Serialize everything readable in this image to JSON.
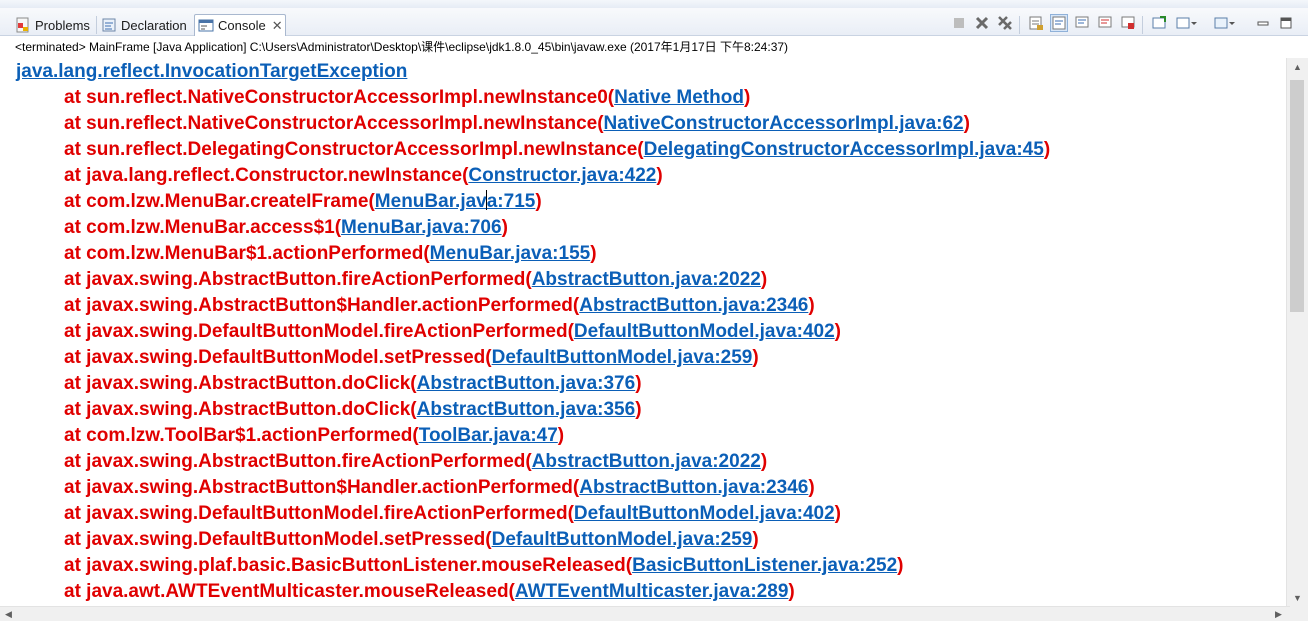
{
  "tabs": [
    {
      "label": "Problems",
      "icon": "problems-icon"
    },
    {
      "label": "Declaration",
      "icon": "declaration-icon"
    },
    {
      "label": "Console",
      "icon": "console-icon",
      "active": true,
      "close": "✕"
    }
  ],
  "toolbar": {
    "buttons": [
      "terminate-icon",
      "remove-launch-icon",
      "remove-all-terminated-icon",
      "scroll-lock-icon",
      "word-wrap-icon",
      "show-when-stdout-icon",
      "show-when-stderr-icon",
      "pin-console-icon",
      "display-console-icon",
      "open-console-icon",
      "minimize-icon",
      "maximize-icon"
    ]
  },
  "status": "<terminated> MainFrame [Java Application] C:\\Users\\Administrator\\Desktop\\课件\\eclipse\\jdk1.8.0_45\\bin\\javaw.exe (2017年1月17日 下午8:24:37)",
  "console": {
    "exception": "java.lang.reflect.InvocationTargetException",
    "frames": [
      {
        "method": "at sun.reflect.NativeConstructorAccessorImpl.newInstance0(",
        "source": "Native Method"
      },
      {
        "method": "at sun.reflect.NativeConstructorAccessorImpl.newInstance(",
        "source": "NativeConstructorAccessorImpl.java:62"
      },
      {
        "method": "at sun.reflect.DelegatingConstructorAccessorImpl.newInstance(",
        "source": "DelegatingConstructorAccessorImpl.java:45"
      },
      {
        "method": "at java.lang.reflect.Constructor.newInstance(",
        "source": "Constructor.java:422"
      },
      {
        "method": "at com.lzw.MenuBar.createIFrame(",
        "source": "MenuBar.java:715",
        "caret": 11
      },
      {
        "method": "at com.lzw.MenuBar.access$1(",
        "source": "MenuBar.java:706"
      },
      {
        "method": "at com.lzw.MenuBar$1.actionPerformed(",
        "source": "MenuBar.java:155"
      },
      {
        "method": "at javax.swing.AbstractButton.fireActionPerformed(",
        "source": "AbstractButton.java:2022"
      },
      {
        "method": "at javax.swing.AbstractButton$Handler.actionPerformed(",
        "source": "AbstractButton.java:2346"
      },
      {
        "method": "at javax.swing.DefaultButtonModel.fireActionPerformed(",
        "source": "DefaultButtonModel.java:402"
      },
      {
        "method": "at javax.swing.DefaultButtonModel.setPressed(",
        "source": "DefaultButtonModel.java:259"
      },
      {
        "method": "at javax.swing.AbstractButton.doClick(",
        "source": "AbstractButton.java:376"
      },
      {
        "method": "at javax.swing.AbstractButton.doClick(",
        "source": "AbstractButton.java:356"
      },
      {
        "method": "at com.lzw.ToolBar$1.actionPerformed(",
        "source": "ToolBar.java:47"
      },
      {
        "method": "at javax.swing.AbstractButton.fireActionPerformed(",
        "source": "AbstractButton.java:2022"
      },
      {
        "method": "at javax.swing.AbstractButton$Handler.actionPerformed(",
        "source": "AbstractButton.java:2346"
      },
      {
        "method": "at javax.swing.DefaultButtonModel.fireActionPerformed(",
        "source": "DefaultButtonModel.java:402"
      },
      {
        "method": "at javax.swing.DefaultButtonModel.setPressed(",
        "source": "DefaultButtonModel.java:259"
      },
      {
        "method": "at javax.swing.plaf.basic.BasicButtonListener.mouseReleased(",
        "source": "BasicButtonListener.java:252"
      },
      {
        "method": "at java.awt.AWTEventMulticaster.mouseReleased(",
        "source": "AWTEventMulticaster.java:289"
      }
    ],
    "close_paren": ")"
  },
  "colors": {
    "error": "#e00000",
    "link": "#0b5fb7"
  }
}
